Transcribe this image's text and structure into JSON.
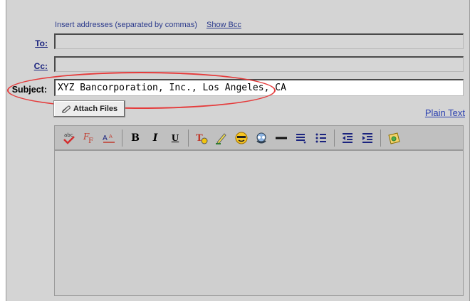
{
  "compose": {
    "hint": "Insert addresses (separated by commas)",
    "show_bcc": "Show Bcc",
    "to_label": "To:",
    "to_value": "",
    "cc_label": "Cc:",
    "cc_value": "",
    "subject_label": "Subject:",
    "subject_value": "XYZ Bancorporation, Inc., Los Angeles, CA",
    "attach_label": "Attach Files",
    "plain_text": "Plain Text"
  },
  "toolbar": {
    "bold": "B",
    "italic": "I",
    "underline": "U"
  },
  "colors": {
    "highlight_ellipse": "#e53b3b",
    "link": "#2a3fb0"
  }
}
